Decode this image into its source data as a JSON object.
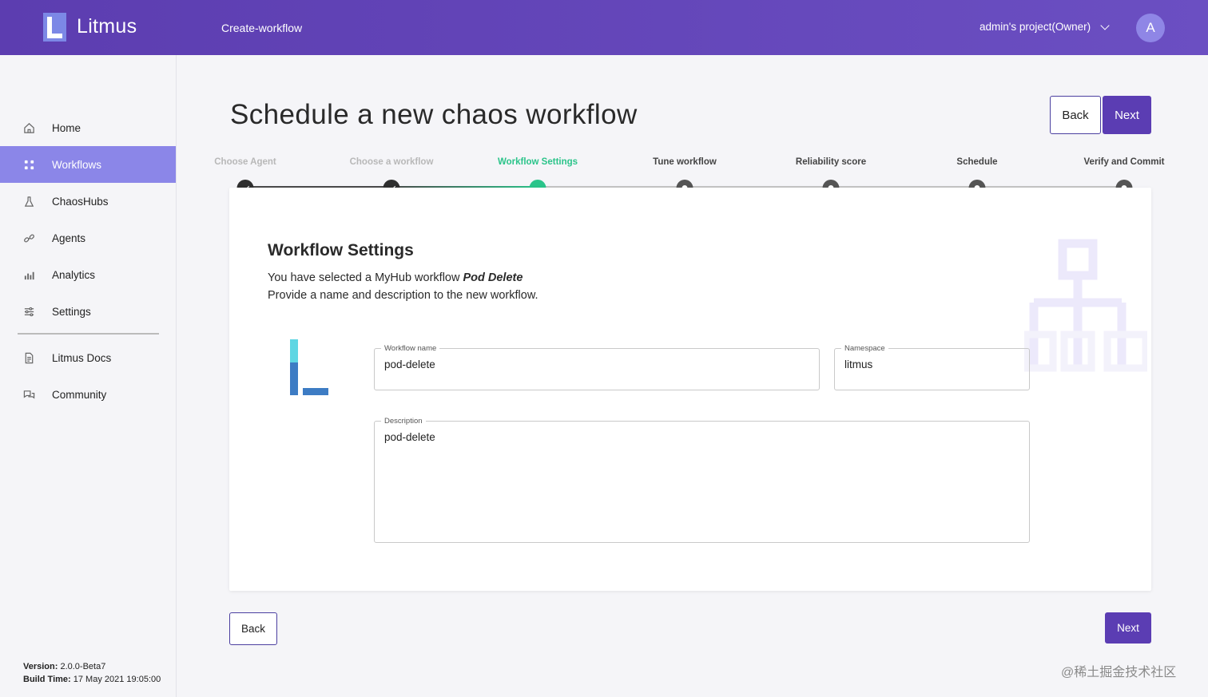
{
  "header": {
    "app_title": "Litmus",
    "page": "Create-workflow",
    "project": "admin's project(Owner)",
    "avatar_initial": "A"
  },
  "sidebar": {
    "items": [
      {
        "label": "Home",
        "icon": "home-icon"
      },
      {
        "label": "Workflows",
        "icon": "workflows-icon",
        "active": true
      },
      {
        "label": "ChaosHubs",
        "icon": "flask-icon"
      },
      {
        "label": "Agents",
        "icon": "link-icon"
      },
      {
        "label": "Analytics",
        "icon": "bar-chart-icon"
      },
      {
        "label": "Settings",
        "icon": "sliders-icon"
      },
      {
        "label": "Litmus Docs",
        "icon": "document-icon"
      },
      {
        "label": "Community",
        "icon": "chat-icon"
      }
    ],
    "version_label": "Version:",
    "version_value": " 2.0.0-Beta7",
    "build_label": "Build Time:",
    "build_value": " 17 May 2021 19:05:00"
  },
  "main": {
    "title": "Schedule a new chaos workflow",
    "back_label": "Back",
    "next_label": "Next"
  },
  "stepper": {
    "current_index": 2,
    "steps": [
      {
        "label": "Choose Agent",
        "status": "done"
      },
      {
        "label": "Choose a workflow",
        "status": "done"
      },
      {
        "label": "Workflow Settings",
        "status": "current"
      },
      {
        "label": "Tune workflow",
        "status": "todo"
      },
      {
        "label": "Reliability score",
        "status": "todo"
      },
      {
        "label": "Schedule",
        "status": "todo"
      },
      {
        "label": "Verify and Commit",
        "status": "todo"
      }
    ]
  },
  "card": {
    "title": "Workflow Settings",
    "line1_prefix": "You have selected a MyHub workflow ",
    "line1_workflow": "Pod Delete",
    "line2": "Provide a name and description to the new workflow.",
    "workflow_name_label": "Workflow name",
    "workflow_name_value": "pod-delete",
    "namespace_label": "Namespace",
    "namespace_value": "litmus",
    "description_label": "Description",
    "description_value": "pod-delete"
  },
  "footer": {
    "back_label": "Back",
    "next_label": "Next"
  },
  "watermark": "@稀土掘金技术社区",
  "colors": {
    "header": "#5c3db0",
    "active_nav": "#8b86e8",
    "step_current": "#2bc48a",
    "primary_button": "#5b3db3"
  }
}
